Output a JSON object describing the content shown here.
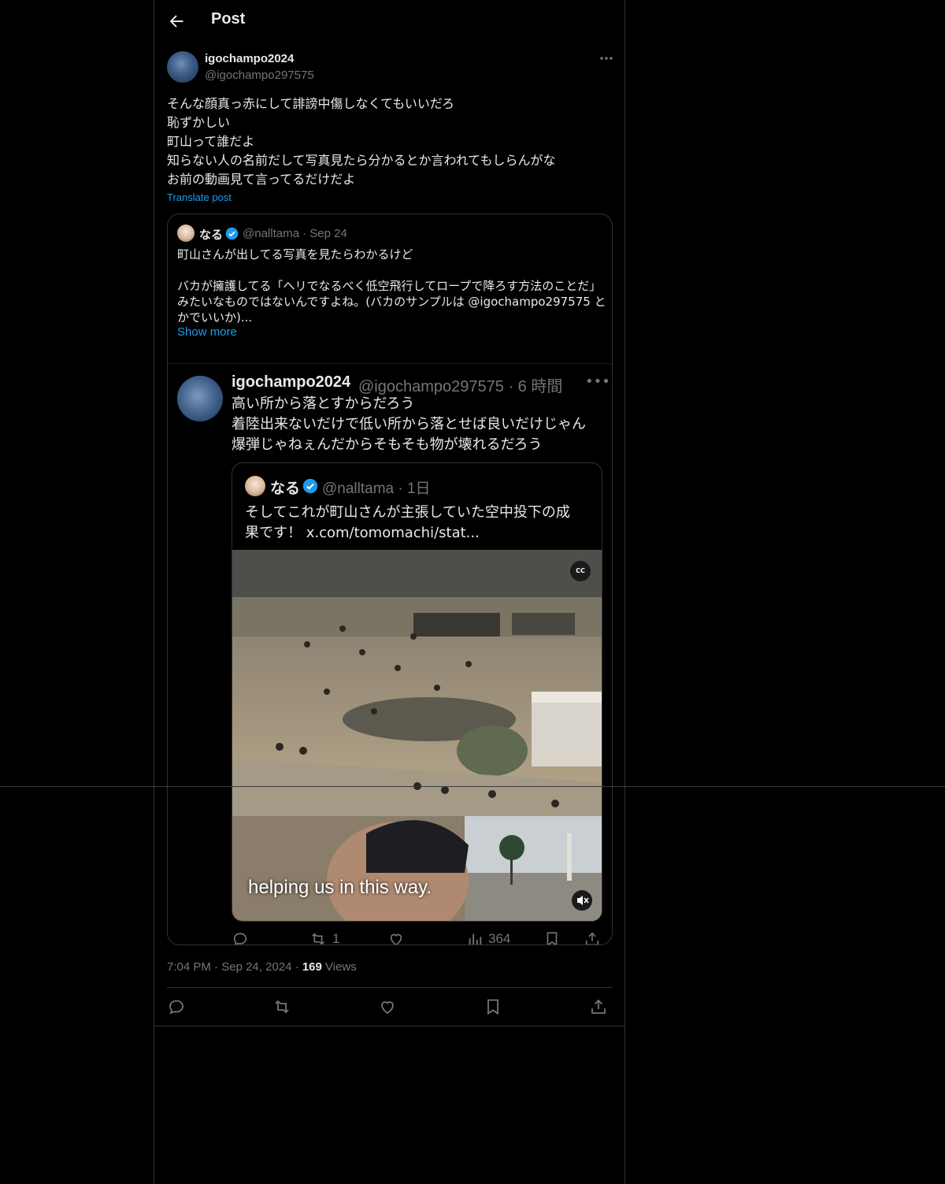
{
  "header": {
    "title": "Post"
  },
  "post": {
    "author_name": "igochampo2024",
    "author_handle": "@igochampo297575",
    "text_lines": [
      "そんな顔真っ赤にして誹謗中傷しなくてもいいだろ",
      "恥ずかしい",
      "町山って誰だよ",
      "知らない人の名前だして写真見たら分かるとか言われてもしらんがな",
      "お前の動画見て言ってるだけだよ"
    ],
    "translate_label": "Translate post",
    "time": "7:04 PM",
    "date": "Sep 24, 2024",
    "views_count": "169",
    "views_label": "Views"
  },
  "quote": {
    "author_name": "なる",
    "author_handle": "@nalltama",
    "date": "Sep 24",
    "text_lines": [
      "町山さんが出してる写真を見たらわかるけど",
      "",
      "バカが擁護してる「ヘリでなるべく低空飛行してロープで降ろす方法のことだ」",
      "みたいなものではないんですよね。(バカのサンプルは @igochampo297575 と",
      "かでいいか)..."
    ],
    "show_more": "Show more",
    "screenshot": {
      "author_name": "igochampo2024",
      "meta": "@igochampo297575 · 6 時間",
      "text_lines": [
        "高い所から落とすからだろう",
        "着陸出来ないだけで低い所から落とせば良いだけじゃん",
        "爆弾じゃねぇんだからそもそも物が壊れるだろう"
      ],
      "inner_author": "なる",
      "inner_meta": "@nalltama · 1日",
      "inner_text_lines": [
        "そしてこれが町山さんが主張していた空中投下の成",
        "果です！ x.com/tomomachi/stat..."
      ],
      "video_caption": "helping us in this way.",
      "cc_label": "CC",
      "retweet_count": "1",
      "views_count": "364"
    }
  },
  "colors": {
    "background": "#000000",
    "text": "#e7e9ea",
    "muted": "#71767b",
    "accent": "#1d9bf0",
    "border": "#2f3336"
  }
}
